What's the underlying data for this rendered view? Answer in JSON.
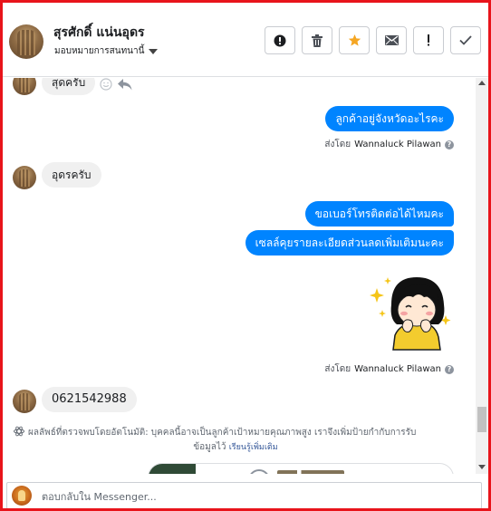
{
  "header": {
    "contact_name": "สุรศักดิ์ แน่นอุดร",
    "assign_label": "มอบหมายการสนทนานี้",
    "actions": [
      {
        "icon": "alert-circle-icon",
        "name": "spam-button"
      },
      {
        "icon": "trash-icon",
        "name": "delete-button"
      },
      {
        "icon": "star-icon",
        "name": "star-button"
      },
      {
        "icon": "envelope-icon",
        "name": "mark-unread-button"
      },
      {
        "icon": "exclamation-icon",
        "name": "follow-up-button"
      },
      {
        "icon": "check-icon",
        "name": "mark-done-button"
      }
    ]
  },
  "messages": {
    "m1": "สุดครับ",
    "m2": "ลูกค้าอยู่จังหวัดอะไรคะ",
    "m3": "อุดรครับ",
    "m4": "ขอเบอร์โทรติดต่อได้ไหมคะ",
    "m5": "เซลล์คุยรายละเอียดส่วนลดเพิ่มเติมนะคะ",
    "m6": "0621542988"
  },
  "sent_by": {
    "prefix": "ส่งโดย",
    "name": "Wannaluck Pilawan"
  },
  "auto_note": {
    "line1": "ผลลัพธ์ที่ตรวจพบโดยอัตโนมัติ: บุคคลนี้อาจเป็นลูกค้าเป้าหมายคุณภาพสูง เราจึงเพิ่มป้ายกำกับการรับ",
    "line2": "ข้อมูลไว้",
    "learn_more": "เรียนรู้เพิ่มเติม"
  },
  "reply": {
    "placeholder": "ตอบกลับใน Messenger..."
  },
  "colors": {
    "outgoing_bubble": "#0084ff",
    "incoming_bubble": "#f0f0f0",
    "star": "#f5a623",
    "frame": "#e8141b"
  }
}
